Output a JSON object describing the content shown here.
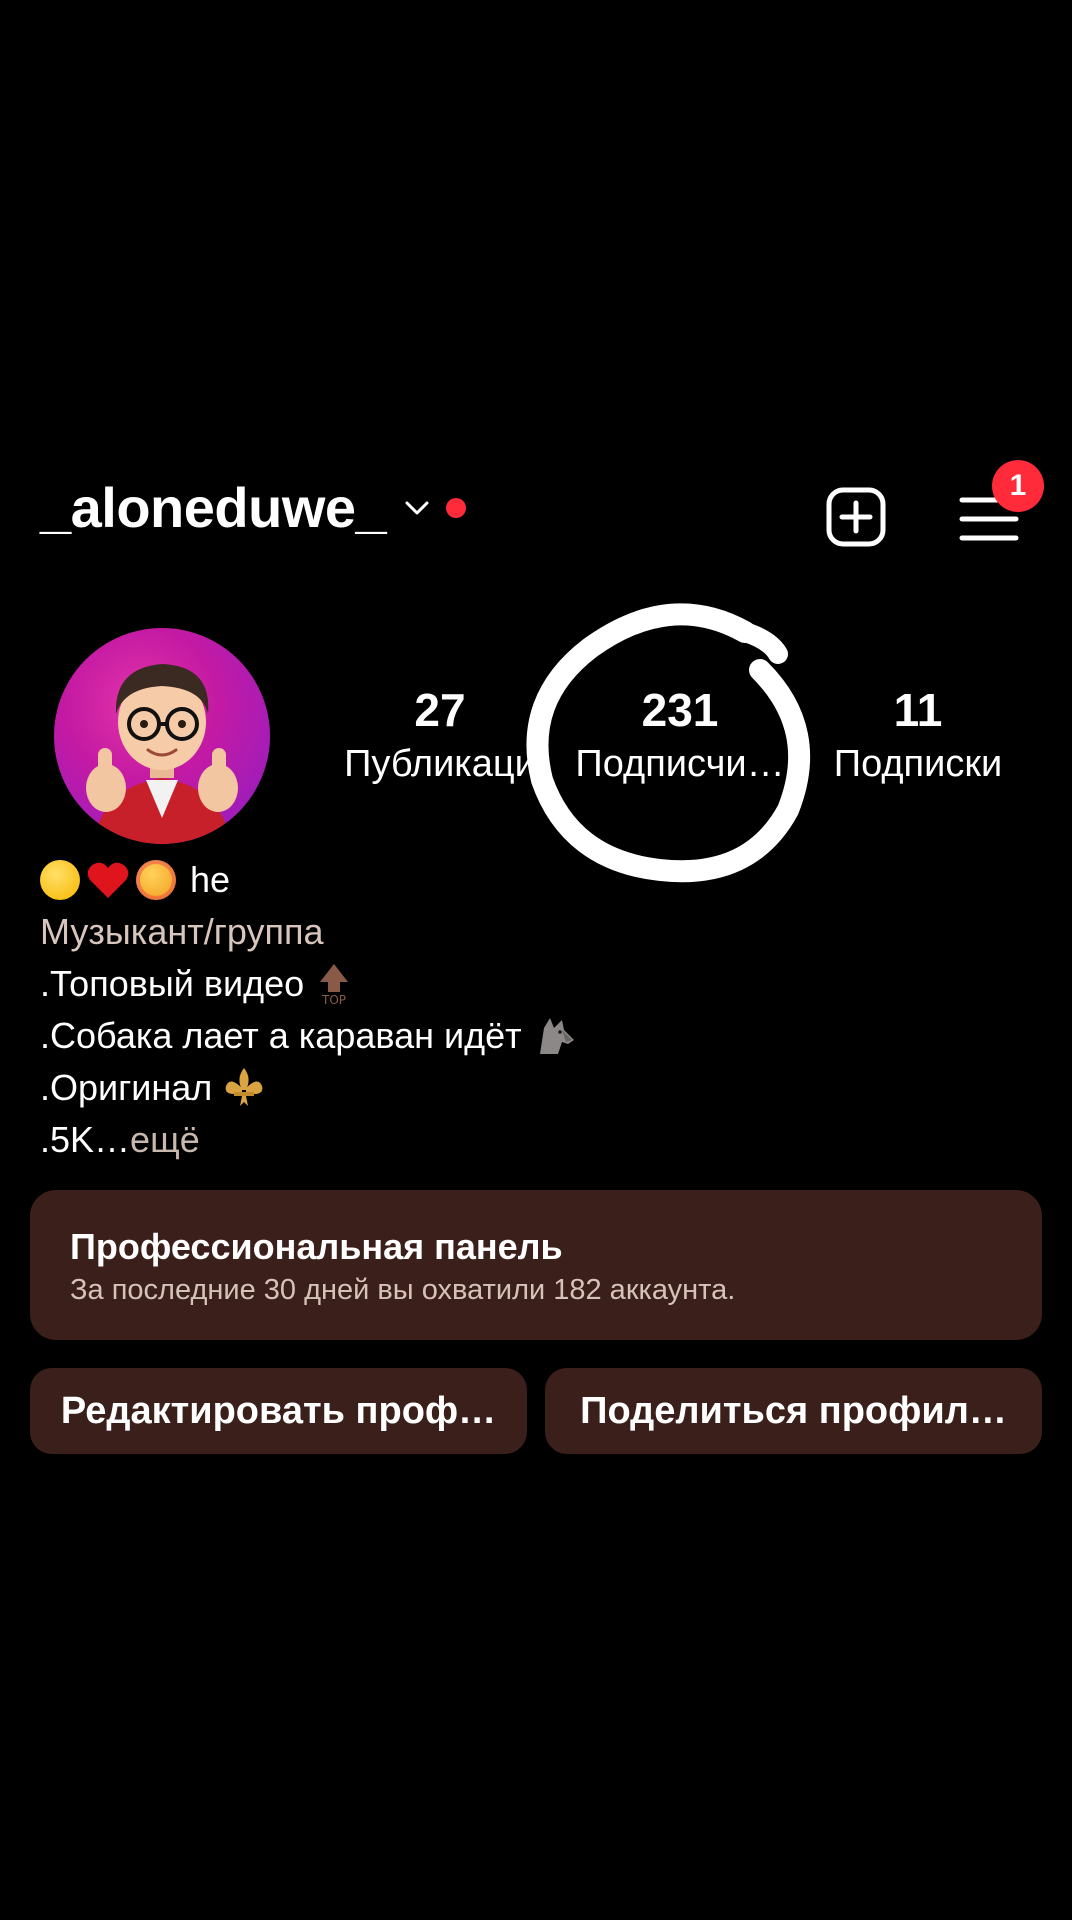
{
  "header": {
    "username": "_aloneduwe_",
    "notification_count": "1"
  },
  "stats": {
    "posts": {
      "value": "27",
      "label": "Публикаци"
    },
    "followers": {
      "value": "231",
      "label": "Подписчи…"
    },
    "following": {
      "value": "11",
      "label": "Подписки"
    }
  },
  "bio": {
    "name_suffix": "he",
    "category": "Музыкант/группа",
    "lines": [
      ".Топовый видео",
      ".Собака лает а караван идёт",
      ".Оригинал"
    ],
    "truncated": ".5K…",
    "more_label": " ещё"
  },
  "pro_panel": {
    "title": "Профессиональная панель",
    "subtitle": "За последние 30 дней вы охватили 182 аккаунта."
  },
  "buttons": {
    "edit": "Редактировать проф…",
    "share": "Поделиться профил…"
  },
  "colors": {
    "background": "#000000",
    "accent_red": "#ff2a3a",
    "panel_bg": "#3a1f1a"
  }
}
